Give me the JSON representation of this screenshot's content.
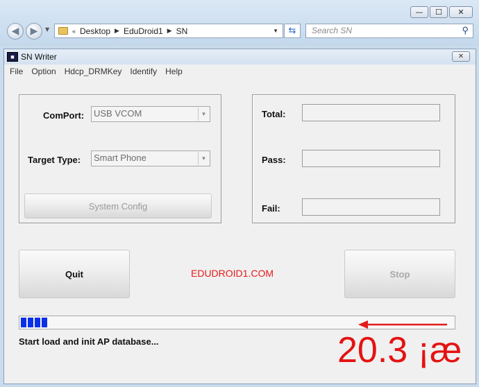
{
  "explorer": {
    "window_buttons": {
      "minimize": "—",
      "maximize": "☐",
      "close": "✕"
    },
    "breadcrumb": [
      "Desktop",
      "EduDroid1",
      "SN"
    ],
    "breadcrumb_prefix": "«",
    "search_placeholder": "Search SN"
  },
  "app": {
    "title": "SN Writer",
    "close_glyph": "✕",
    "menu": [
      "File",
      "Option",
      "Hdcp_DRMKey",
      "Identify",
      "Help"
    ],
    "left_panel": {
      "comport_label": "ComPort:",
      "comport_value": "USB VCOM",
      "target_label": "Target Type:",
      "target_value": "Smart Phone",
      "system_config_label": "System Config"
    },
    "right_panel": {
      "total_label": "Total:",
      "pass_label": "Pass:",
      "fail_label": "Fail:"
    },
    "quit_label": "Quit",
    "stop_label": "Stop",
    "watermark": "EDUDROID1.COM",
    "progress": {
      "chunks": 4
    },
    "status": "Start load and init AP database...",
    "annotation": "20.3 ¡æ",
    "colors": {
      "accent_red": "#e51a1a",
      "progress_blue": "#0a2fe8"
    }
  }
}
